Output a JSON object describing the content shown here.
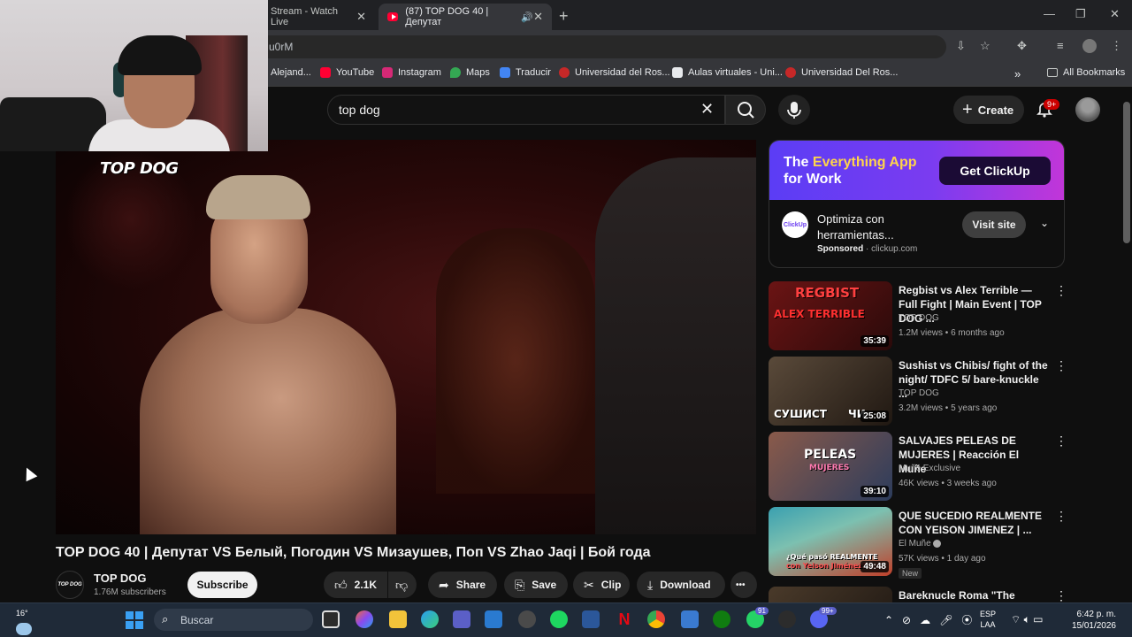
{
  "browser": {
    "tabs": [
      {
        "label": "Stream - Watch Live",
        "active": false
      },
      {
        "label": "(87) TOP DOG 40 | Депутат",
        "active": true
      }
    ],
    "new_tab": "+",
    "address": "u0rM",
    "window_controls": {
      "minimize": "—",
      "maximize": "❐",
      "close": "✕"
    },
    "bookmarks": [
      {
        "label": "Alejand...",
        "color": "#4285f4"
      },
      {
        "label": "YouTube",
        "color": "#ff0033"
      },
      {
        "label": "Instagram",
        "color": "#d62976"
      },
      {
        "label": "Maps",
        "color": "#34a853"
      },
      {
        "label": "Traducir",
        "color": "#4285f4"
      },
      {
        "label": "Universidad del Ros...",
        "color": "#c62828"
      },
      {
        "label": "Aulas virtuales - Uni...",
        "color": "#222222"
      },
      {
        "label": "Universidad Del Ros...",
        "color": "#c62828"
      }
    ],
    "bookmarks_more": "»",
    "all_bookmarks": "All Bookmarks"
  },
  "youtube": {
    "search": {
      "value": "top dog",
      "clear": "✕"
    },
    "create_label": "Create",
    "notifications_badge": "9+"
  },
  "video": {
    "logo": "TOP DOG",
    "title": "TOP DOG 40 | Депутат VS Белый, Погодин VS Мизаушев, Поп VS Zhao Jaqi | Бой года",
    "channel": {
      "name": "TOP DOG",
      "subscribers": "1.76M subscribers",
      "avatar_text": "TOP DOG"
    },
    "subscribe_label": "Subscribe",
    "actions": {
      "likes": "2.1K",
      "share": "Share",
      "save": "Save",
      "clip": "Clip",
      "download": "Download",
      "more": "•••"
    }
  },
  "ad": {
    "headline_pre": "The ",
    "headline_highlight": "Everything App",
    "headline_post": " for Work",
    "cta": "Get ClickUp",
    "logo_text": "ClickUp",
    "text": "Optimiza con herramientas...",
    "sponsored": "Sponsored",
    "domain": " · clickup.com",
    "visit": "Visit site",
    "chevron": "⌄"
  },
  "related": [
    {
      "title": "Regbist vs Alex Terrible — Full Fight | Main Event | TOP DOG ...",
      "channel": "TOP DOG",
      "meta": "1.2M views • 6 months ago",
      "duration": "35:39",
      "thumb_text": "REGBIST",
      "thumb_text2": "ALEX TERRIBLE",
      "colors": [
        "#6b1414",
        "#2a0a0a"
      ]
    },
    {
      "title": "Sushist vs Chibis/ fight of the night/ TDFC 5/ bare-knuckle ...",
      "channel": "TOP DOG",
      "meta": "3.2M views • 5 years ago",
      "duration": "25:08",
      "thumb_text": "СУШИСТ",
      "thumb_text2": "ЧИ",
      "colors": [
        "#5a4a3a",
        "#201812"
      ]
    },
    {
      "title": "SALVAJES PELEAS DE MUJERES | Reacción El Muñe",
      "channel": "Muñe Exclusive",
      "meta": "46K views • 3 weeks ago",
      "duration": "39:10",
      "thumb_text": "PELEAS",
      "thumb_text2": "MUJERES",
      "colors": [
        "#8a5a4a",
        "#2c3c5c"
      ]
    },
    {
      "title": "QUE SUCEDIO REALMENTE CON YEISON JIMENEZ | ...",
      "channel": "El Muñe",
      "meta": "57K views • 1 day ago",
      "duration": "49:48",
      "badge": "New",
      "thumb_text": "¿Qué pasó REALMENTE",
      "thumb_text2": "con Yeison Jiménez?",
      "colors": [
        "#3aa0b0",
        "#c0402a"
      ]
    },
    {
      "title": "Bareknucle Roma \"The",
      "channel": "",
      "meta": "",
      "duration": "",
      "thumb_text": "",
      "thumb_text2": "",
      "colors": [
        "#4a3a2a",
        "#1a1410"
      ]
    }
  ],
  "taskbar": {
    "weather": "16°",
    "search_placeholder": "Buscar",
    "badges": [
      "91",
      "99+"
    ],
    "lang": [
      "ESP",
      "LAA"
    ],
    "time": "6:42 p. m.",
    "date": "15/01/2026"
  }
}
